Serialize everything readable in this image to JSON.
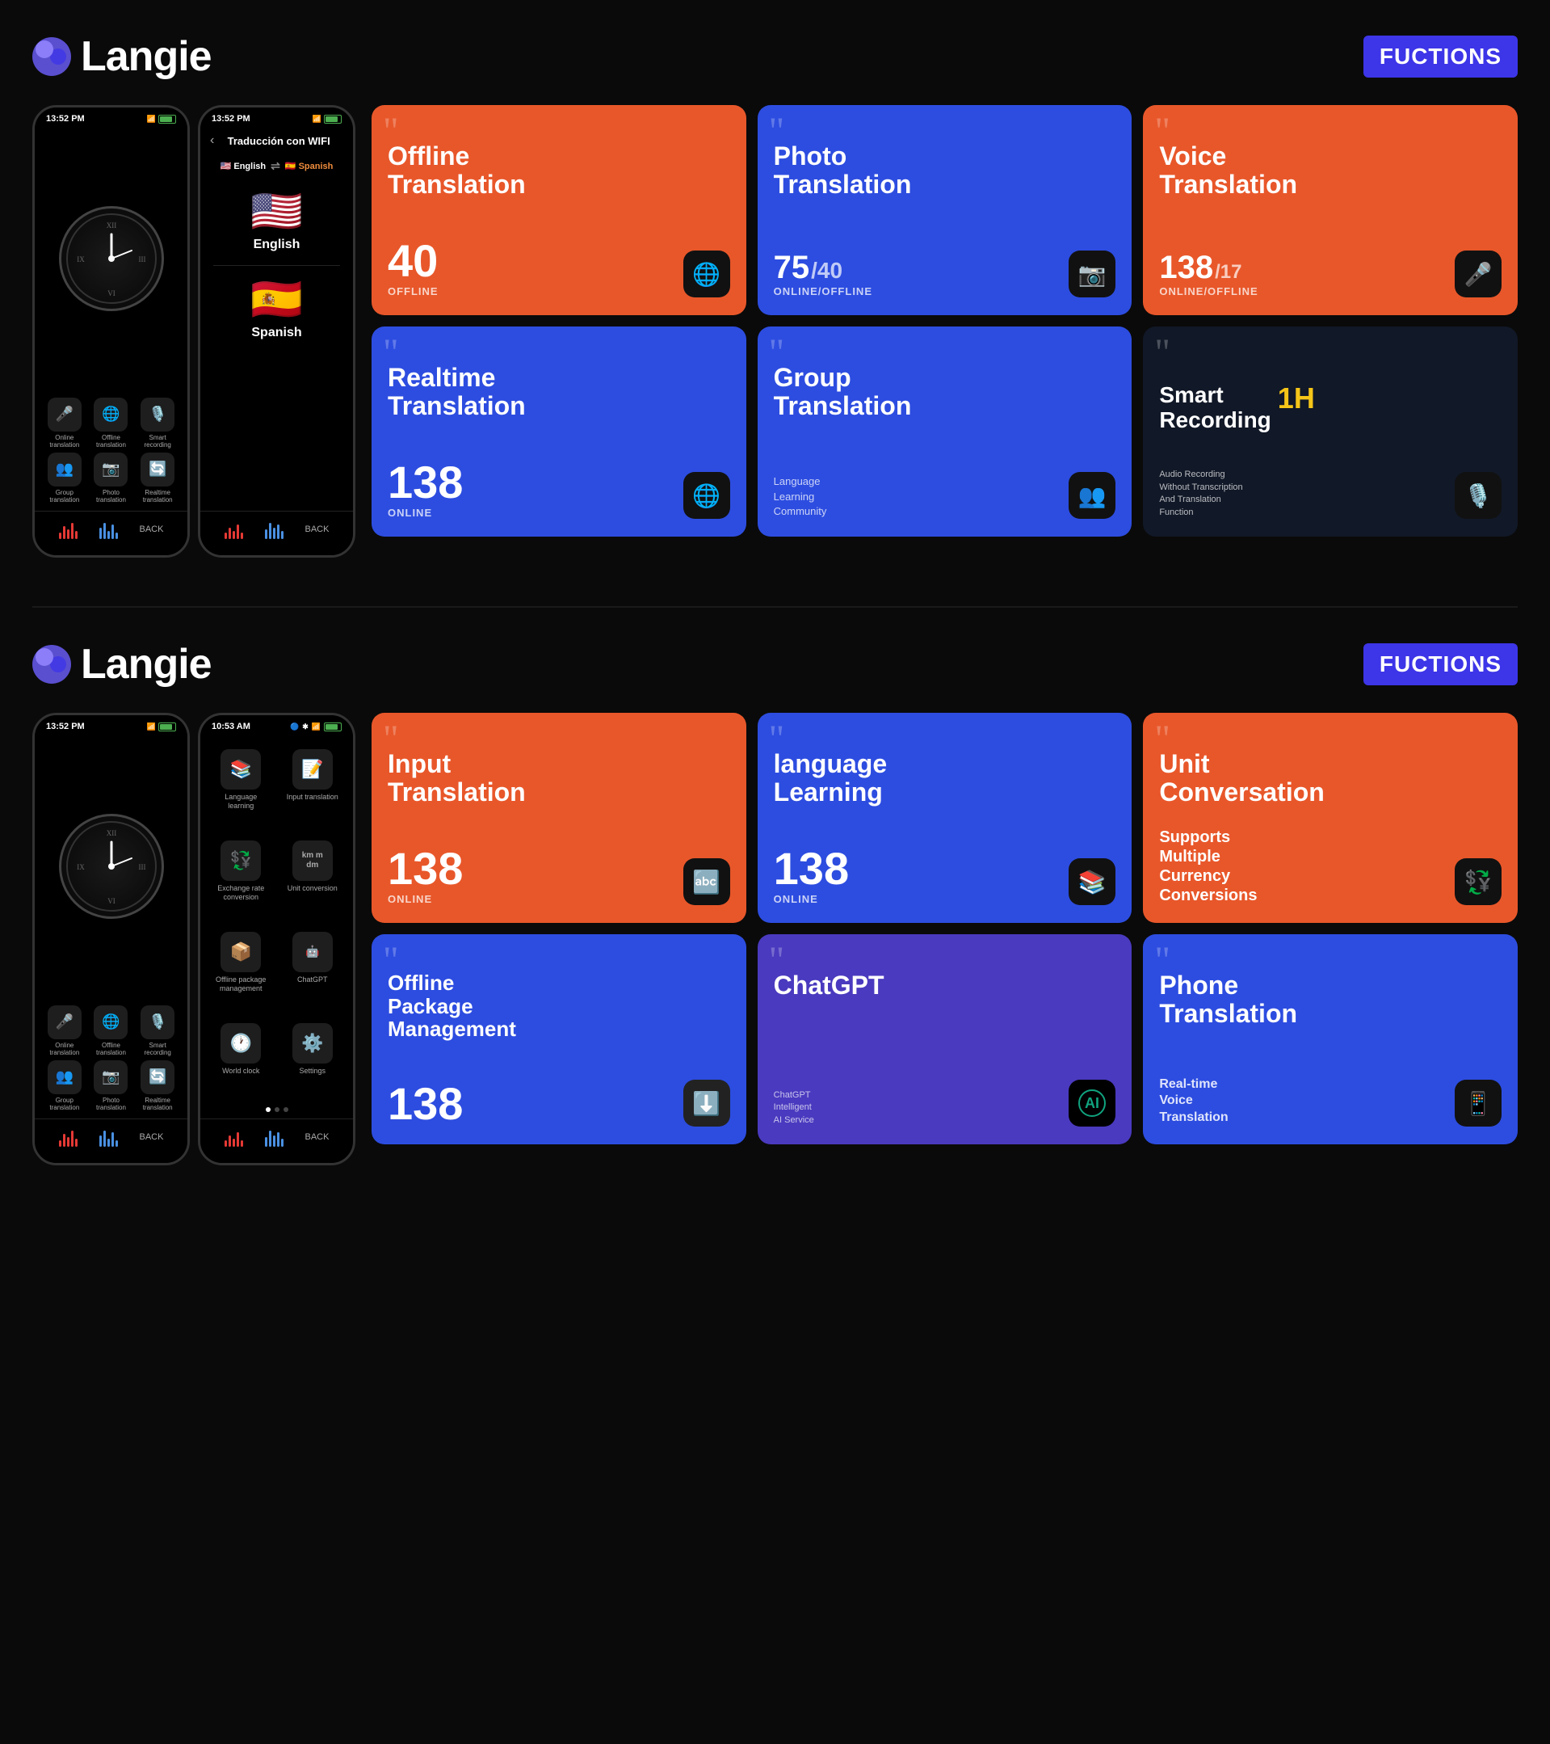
{
  "sections": [
    {
      "id": "section1",
      "logo": "Langie",
      "badge": "FUCTIONS",
      "phones": [
        {
          "time": "13:52 PM",
          "type": "home"
        },
        {
          "time": "13:52 PM",
          "type": "translation",
          "nav_title": "Traducción con WIFI",
          "lang_from": "🇺🇸 English",
          "lang_to": "🇪🇸 Spanish",
          "lang1": "English",
          "flag1": "🇺🇸",
          "lang2": "Spanish",
          "flag2": "🇪🇸"
        }
      ],
      "cards": [
        {
          "id": "offline-translation",
          "color": "orange",
          "title": "Offline Translation",
          "number": "40",
          "label": "OFFLINE",
          "icon": "🌐"
        },
        {
          "id": "photo-translation",
          "color": "blue",
          "title": "Photo Translation",
          "number": "75",
          "sub_number": "40",
          "label": "ONLINE/OFFLINE",
          "icon": "📷"
        },
        {
          "id": "voice-translation",
          "color": "orange",
          "title": "Voice Translation",
          "number": "138",
          "sub_number": "17",
          "label": "ONLINE/OFFLINE",
          "icon": "🎤"
        },
        {
          "id": "realtime-translation",
          "color": "blue",
          "title": "Realtime Translation",
          "number": "138",
          "label": "ONLINE",
          "icon": "🌐"
        },
        {
          "id": "group-translation",
          "color": "blue",
          "title": "Group Translation",
          "sub_title": "Language Learning Community",
          "icon": "👥"
        },
        {
          "id": "smart-recording",
          "color": "dark",
          "title": "Smart Recording",
          "badge": "1H",
          "desc": "Audio Recording Without Transcription And Translation Function",
          "icon": "🎙️"
        }
      ]
    },
    {
      "id": "section2",
      "logo": "Langie",
      "badge": "FUCTIONS",
      "phones": [
        {
          "time": "13:52 PM",
          "type": "home"
        },
        {
          "time": "10:53 AM",
          "type": "menu",
          "items": [
            {
              "icon": "📚",
              "label": "Language learning"
            },
            {
              "icon": "📝",
              "label": "Input translation"
            },
            {
              "icon": "💱",
              "label": "Exchange rate conversion"
            },
            {
              "icon": "📏",
              "label": "Unit conversion"
            },
            {
              "icon": "📦",
              "label": "Offline package management"
            },
            {
              "icon": "🤖",
              "label": "ChatGPT"
            },
            {
              "icon": "🕐",
              "label": "World clock"
            },
            {
              "icon": "⚙️",
              "label": "Settings"
            }
          ]
        }
      ],
      "cards": [
        {
          "id": "input-translation",
          "color": "orange",
          "title": "Input Translation",
          "number": "138",
          "label": "ONLINE",
          "icon": "🔤"
        },
        {
          "id": "language-learning",
          "color": "blue",
          "title": "language Learning",
          "number": "138",
          "label": "ONLINE",
          "icon": "📚"
        },
        {
          "id": "unit-conversation",
          "color": "orange",
          "title": "Unit Conversation",
          "desc": "Supports Multiple Currency Conversions",
          "icon": "💱"
        },
        {
          "id": "offline-package",
          "color": "blue",
          "title": "Offline Package Management",
          "number": "138",
          "label": "",
          "icon": "⬇️"
        },
        {
          "id": "chatgpt",
          "color": "purple",
          "title": "ChatGPT",
          "desc": "ChatGPT Intelligent AI Service",
          "icon": "🤖"
        },
        {
          "id": "phone-translation",
          "color": "blue",
          "title": "Phone Translation",
          "desc": "Real-time Voice Translation",
          "icon": "📱"
        }
      ]
    }
  ],
  "home_phone_icons": [
    {
      "icon": "🎤",
      "label": "Online\ntranslation"
    },
    {
      "icon": "🌐",
      "label": "Offline\ntranslation"
    },
    {
      "icon": "🎙️",
      "label": "Smart\nrecording"
    },
    {
      "icon": "👥",
      "label": "Group\ntranslation"
    },
    {
      "icon": "📷",
      "label": "Photo\ntranslation"
    },
    {
      "icon": "🔄",
      "label": "Realtime\ntranslation"
    }
  ]
}
